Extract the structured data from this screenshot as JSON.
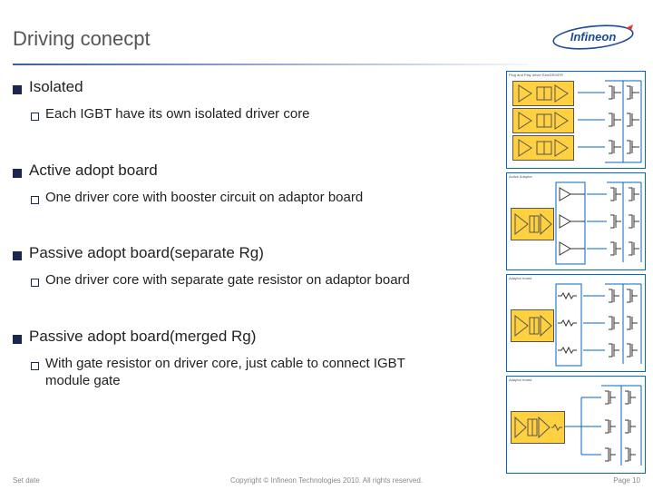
{
  "title": "Driving conecpt",
  "logo_text": "Infineon",
  "brand_color": "#1b4a9a",
  "sections": [
    {
      "heading": "Isolated",
      "sub": "Each IGBT have its own isolated driver core"
    },
    {
      "heading": "Active adopt board",
      "sub": "One driver core with booster circuit on adaptor board"
    },
    {
      "heading": "Passive adopt board(separate Rg)",
      "sub": "One driver core with separate gate resistor on adaptor board"
    },
    {
      "heading": "Passive adopt board(merged Rg)",
      "sub": "With gate resistor on driver core, just cable to connect IGBT module gate"
    }
  ],
  "diagrams": {
    "d1_label": "Plug and Play driver EiceDRIVER",
    "d2_label": "Active Adaptor",
    "d3_label": "Adaptor board",
    "d4_label": "Adaptor board"
  },
  "footer": {
    "left": "Set date",
    "center": "Copyright © Infineon Technologies 2010. All rights reserved.",
    "right": "Page 10"
  }
}
